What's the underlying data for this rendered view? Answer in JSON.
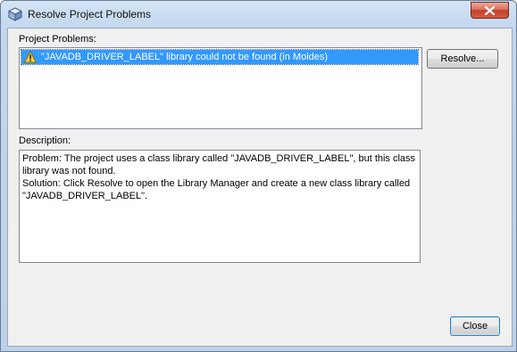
{
  "window": {
    "title": "Resolve Project Problems",
    "icon": "netbeans-cube-icon",
    "close_icon": "close-x-icon"
  },
  "problems": {
    "label": "Project Problems:",
    "items": [
      {
        "icon": "warning-icon",
        "text": "\"JAVADB_DRIVER_LABEL\" library could not be found (in Moldes)",
        "selected": true
      }
    ]
  },
  "description": {
    "label": "Description:",
    "lines": [
      "Problem: The project uses a class library called \"JAVADB_DRIVER_LABEL\", but this class",
      "library was not found.",
      "Solution: Click Resolve to open the Library Manager and create a new class library called",
      "\"JAVADB_DRIVER_LABEL\"."
    ]
  },
  "buttons": {
    "resolve": "Resolve...",
    "close": "Close"
  },
  "colors": {
    "selection": "#3399ff",
    "close_button": "#c4402b"
  }
}
